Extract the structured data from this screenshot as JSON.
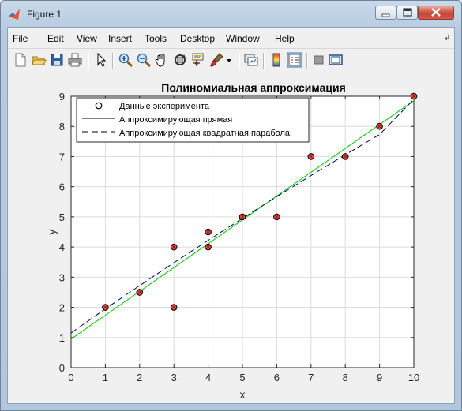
{
  "window": {
    "title": "Figure 1"
  },
  "menu": [
    "File",
    "Edit",
    "View",
    "Insert",
    "Tools",
    "Desktop",
    "Window",
    "Help"
  ],
  "toolbar_icons": [
    "new-figure-icon",
    "open-file-icon",
    "save-icon",
    "print-icon",
    "edit-plot-arrow-icon",
    "zoom-in-icon",
    "zoom-out-icon",
    "pan-hand-icon",
    "rotate-3d-icon",
    "data-cursor-icon",
    "brush-icon",
    "brush-dropdown-icon",
    "link-plot-icon",
    "insert-colorbar-icon",
    "insert-legend-icon",
    "hide-plot-tools-icon",
    "show-plot-tools-icon"
  ],
  "chart_data": {
    "type": "scatter",
    "title": "Полиномиальная аппроксимация",
    "xlabel": "x",
    "ylabel": "y",
    "xlim": [
      0,
      10
    ],
    "ylim": [
      0,
      9
    ],
    "xticks": [
      "0",
      "1",
      "2",
      "3",
      "4",
      "5",
      "6",
      "7",
      "8",
      "9",
      "10"
    ],
    "yticks": [
      "0",
      "1",
      "2",
      "3",
      "4",
      "5",
      "6",
      "7",
      "8",
      "9"
    ],
    "grid": true,
    "legend_placement": "top-left",
    "series": [
      {
        "name": "Данные эксперимента",
        "kind": "markers",
        "marker": "circle",
        "x": [
          1,
          2,
          3,
          3,
          4,
          4,
          5,
          6,
          7,
          8,
          9,
          10
        ],
        "y": [
          2,
          2.5,
          4,
          2,
          4,
          4.5,
          5,
          5,
          7,
          7,
          8,
          9
        ]
      },
      {
        "name": "Аппроксимирующая прямая",
        "kind": "line",
        "style": "solid",
        "color": "#00cc00",
        "x": [
          0,
          10
        ],
        "y": [
          0.95,
          8.85
        ]
      },
      {
        "name": "Аппроксимирующая квадратная парабола",
        "kind": "line",
        "style": "dashed",
        "color": "#000066",
        "x": [
          0,
          1,
          2,
          3,
          4,
          5,
          6,
          7,
          8,
          9,
          10
        ],
        "y": [
          1.15,
          1.95,
          2.72,
          3.48,
          4.22,
          4.95,
          5.67,
          6.37,
          7.06,
          7.73,
          8.9
        ]
      }
    ]
  }
}
